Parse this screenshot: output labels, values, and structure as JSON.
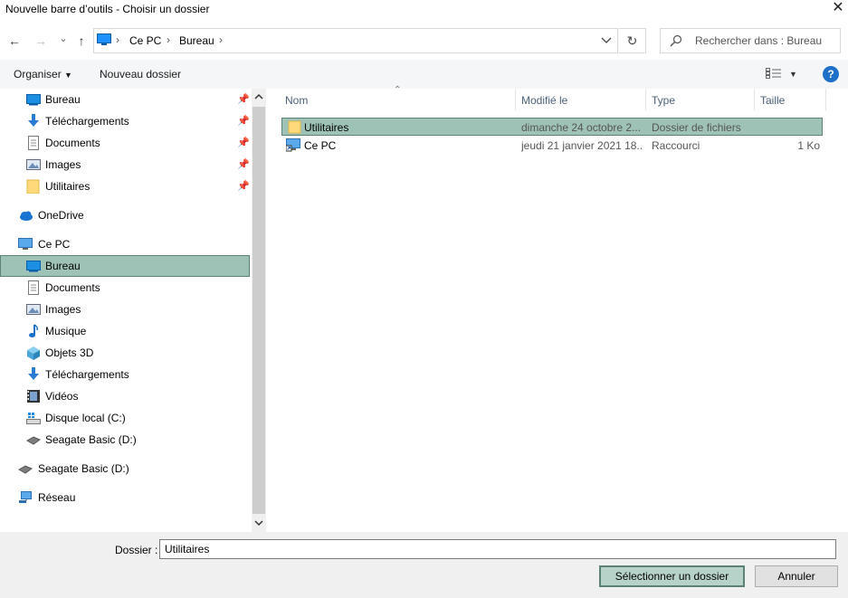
{
  "window": {
    "title": "Nouvelle barre d’outils - Choisir un dossier"
  },
  "nav": {
    "back": "←",
    "forward": "→",
    "recent": "⌄",
    "up": "↑",
    "refresh": "↻"
  },
  "address": {
    "crumbs": [
      "Ce PC",
      "Bureau"
    ],
    "sep": "›"
  },
  "search": {
    "placeholder": "Rechercher dans : Bureau"
  },
  "toolbar": {
    "organize": "Organiser",
    "new_folder": "Nouveau dossier",
    "help": "?"
  },
  "sidebar": {
    "quick_access": [
      {
        "label": "Bureau",
        "icon": "desktop-icon",
        "pinned": true
      },
      {
        "label": "Téléchargements",
        "icon": "download-icon",
        "pinned": true
      },
      {
        "label": "Documents",
        "icon": "documents-icon",
        "pinned": true
      },
      {
        "label": "Images",
        "icon": "images-icon",
        "pinned": true
      },
      {
        "label": "Utilitaires",
        "icon": "folder-icon",
        "pinned": true
      }
    ],
    "onedrive": {
      "label": "OneDrive",
      "icon": "cloud-icon"
    },
    "this_pc": {
      "label": "Ce PC",
      "icon": "computer-icon"
    },
    "pc_items": [
      {
        "label": "Bureau",
        "icon": "desktop-icon",
        "selected": true
      },
      {
        "label": "Documents",
        "icon": "documents-icon"
      },
      {
        "label": "Images",
        "icon": "images-icon"
      },
      {
        "label": "Musique",
        "icon": "music-icon"
      },
      {
        "label": "Objets 3D",
        "icon": "3d-objects-icon"
      },
      {
        "label": "Téléchargements",
        "icon": "download-icon"
      },
      {
        "label": "Vidéos",
        "icon": "video-icon"
      },
      {
        "label": "Disque local (C:)",
        "icon": "local-disk-icon"
      },
      {
        "label": "Seagate Basic (D:)",
        "icon": "drive-icon"
      }
    ],
    "seagate": {
      "label": "Seagate Basic (D:)",
      "icon": "drive-icon"
    },
    "network": {
      "label": "Réseau",
      "icon": "network-icon"
    }
  },
  "columns": {
    "name": "Nom",
    "modified": "Modifié le",
    "type": "Type",
    "size": "Taille"
  },
  "files": [
    {
      "name": "Utilitaires",
      "modified": "dimanche 24 octobre 2...",
      "type": "Dossier de fichiers",
      "size": "",
      "icon": "folder-icon",
      "selected": true
    },
    {
      "name": "Ce PC",
      "modified": "jeudi 21 janvier 2021 18...",
      "type": "Raccourci",
      "size": "1 Ko",
      "icon": "shortcut-computer-icon",
      "selected": false
    }
  ],
  "footer": {
    "folder_label": "Dossier :",
    "folder_value": "Utilitaires",
    "select_button": "Sélectionner un dossier",
    "cancel_button": "Annuler"
  },
  "colors": {
    "selection": "#9ec2b6",
    "selection_border": "#5b8275",
    "accent": "#1e6fc7"
  }
}
